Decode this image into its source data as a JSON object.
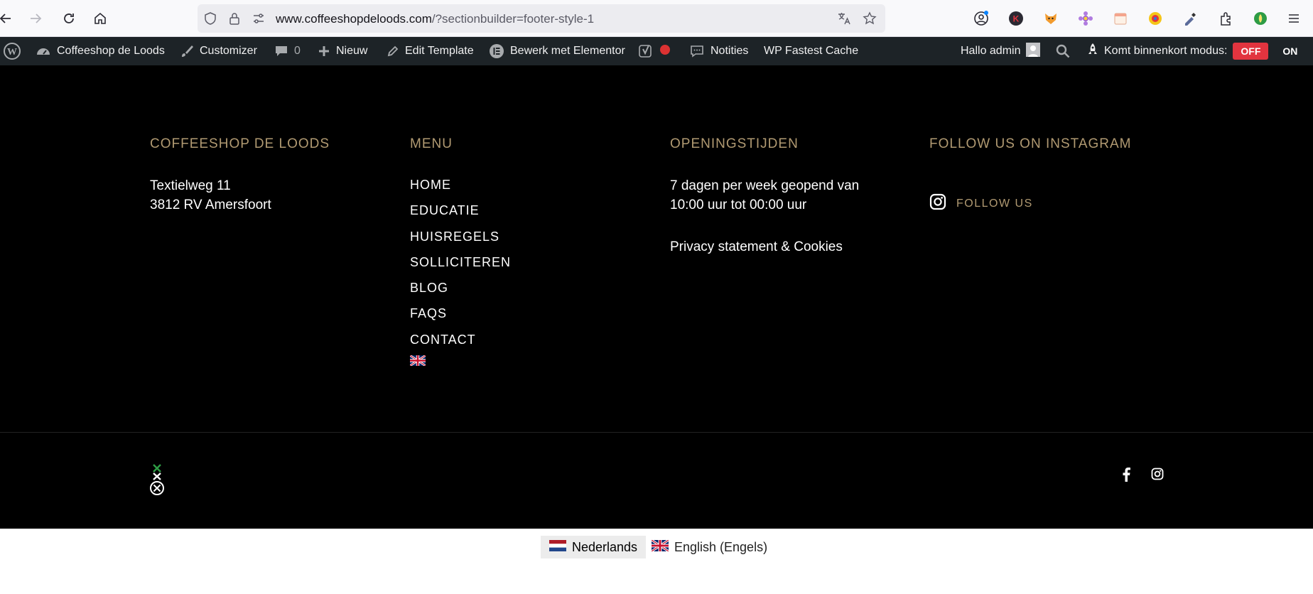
{
  "browser": {
    "url_host": "www.coffeeshopdeloods.com",
    "url_path": "/?sectionbuilder=footer-style-1"
  },
  "adminbar": {
    "site_name": "Coffeeshop de Loods",
    "customizer": "Customizer",
    "comments_count": "0",
    "new": "Nieuw",
    "edit_template": "Edit Template",
    "elementor": "Bewerk met Elementor",
    "notifications": "Notities",
    "cache": "WP Fastest Cache",
    "greeting": "Hallo admin",
    "coming_soon_label": "Komt binnenkort modus:",
    "toggle_off": "OFF",
    "toggle_on": "ON"
  },
  "footer": {
    "col1": {
      "title": "COFFEESHOP DE LOODS",
      "address_line1": "Textielweg 11",
      "address_line2": "3812 RV Amersfoort"
    },
    "col2": {
      "title": "MENU",
      "items": [
        "HOME",
        "EDUCATIE",
        "HUISREGELS",
        "SOLLICITEREN",
        "BLOG",
        "FAQS",
        "CONTACT"
      ]
    },
    "col3": {
      "title": "OPENINGSTIJDEN",
      "line1": "7 dagen per week geopend van",
      "line2": "10:00 uur tot 00:00 uur",
      "privacy": "Privacy statement & Cookies"
    },
    "col4": {
      "title": "FOLLOW US ON INSTAGRAM",
      "follow": "FOLLOW US"
    },
    "colors": {
      "accent": "#b19a72",
      "background": "#000000"
    }
  },
  "languages": [
    {
      "label": "Nederlands",
      "active": true
    },
    {
      "label": "English (Engels)",
      "active": false
    }
  ]
}
